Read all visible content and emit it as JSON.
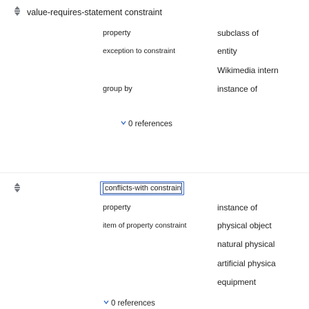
{
  "statement1": {
    "title": "value-requires-statement constraint",
    "qualifiers": [
      {
        "property": "property",
        "values": [
          "subclass of"
        ]
      },
      {
        "property": "exception to constraint",
        "values": [
          "entity",
          "Wikimedia intern"
        ]
      },
      {
        "property": "group by",
        "values": [
          "instance of"
        ]
      }
    ],
    "references_label": "0 references"
  },
  "statement2": {
    "title": "conflicts-with constraint",
    "qualifiers": [
      {
        "property": "property",
        "values": [
          "instance of"
        ]
      },
      {
        "property": "item of property constraint",
        "values": [
          "physical object",
          "natural physical",
          "artificial physica",
          "equipment"
        ]
      }
    ],
    "references_label": "0 references"
  },
  "colors": {
    "accent": "#3366cc",
    "text": "#222222",
    "muted": "#72777d"
  },
  "icons": {
    "rank": "normal-rank-icon",
    "chevron": "chevron-down-icon"
  }
}
